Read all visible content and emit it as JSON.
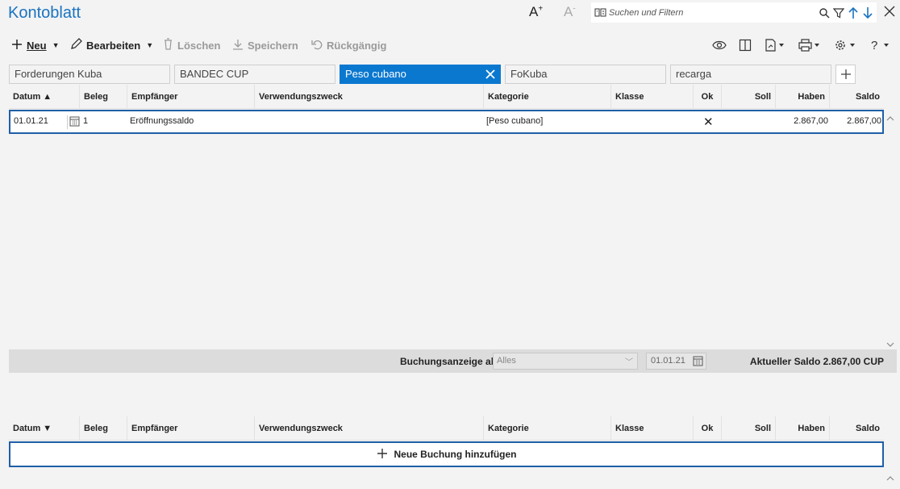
{
  "app": {
    "title": "Kontoblatt"
  },
  "font_controls": {
    "increase": "A",
    "increase_sup": "+",
    "decrease": "A",
    "decrease_sup": "-"
  },
  "search": {
    "placeholder": "Suchen und Filtern",
    "value": ""
  },
  "toolbar": {
    "new_label": "Neu",
    "edit_label": "Bearbeiten",
    "delete_label": "Löschen",
    "save_label": "Speichern",
    "undo_label": "Rückgängig"
  },
  "tabs": [
    {
      "label": "Forderungen Kuba",
      "active": false
    },
    {
      "label": "BANDEC CUP",
      "active": false
    },
    {
      "label": "Peso cubano",
      "active": true
    },
    {
      "label": "FoKuba",
      "active": false
    },
    {
      "label": "recarga",
      "active": false
    }
  ],
  "columns": {
    "date_asc": "Datum ▲",
    "date_desc": "Datum ▼",
    "receipt": "Beleg",
    "recipient": "Empfänger",
    "purpose": "Verwendungszweck",
    "category": "Kategorie",
    "class": "Klasse",
    "ok": "Ok",
    "debit": "Soll",
    "credit": "Haben",
    "balance": "Saldo"
  },
  "transactions": [
    {
      "date": "01.01.21",
      "receipt": "1",
      "recipient": "Eröffnungssaldo",
      "purpose": "",
      "category": "[Peso cubano]",
      "class": "",
      "ok": "✕",
      "debit": "",
      "credit": "2.867,00",
      "balance": "2.867,00"
    }
  ],
  "filter": {
    "label": "Buchungsanzeige ab",
    "select_value": "Alles",
    "date": "01.01.21",
    "current_balance": "Aktueller Saldo 2.867,00 CUP"
  },
  "new_entry": {
    "label": "Neue Buchung hinzufügen"
  },
  "colors": {
    "accent": "#0b78d0",
    "title": "#1a73c0",
    "row_border": "#1f5fa8"
  }
}
